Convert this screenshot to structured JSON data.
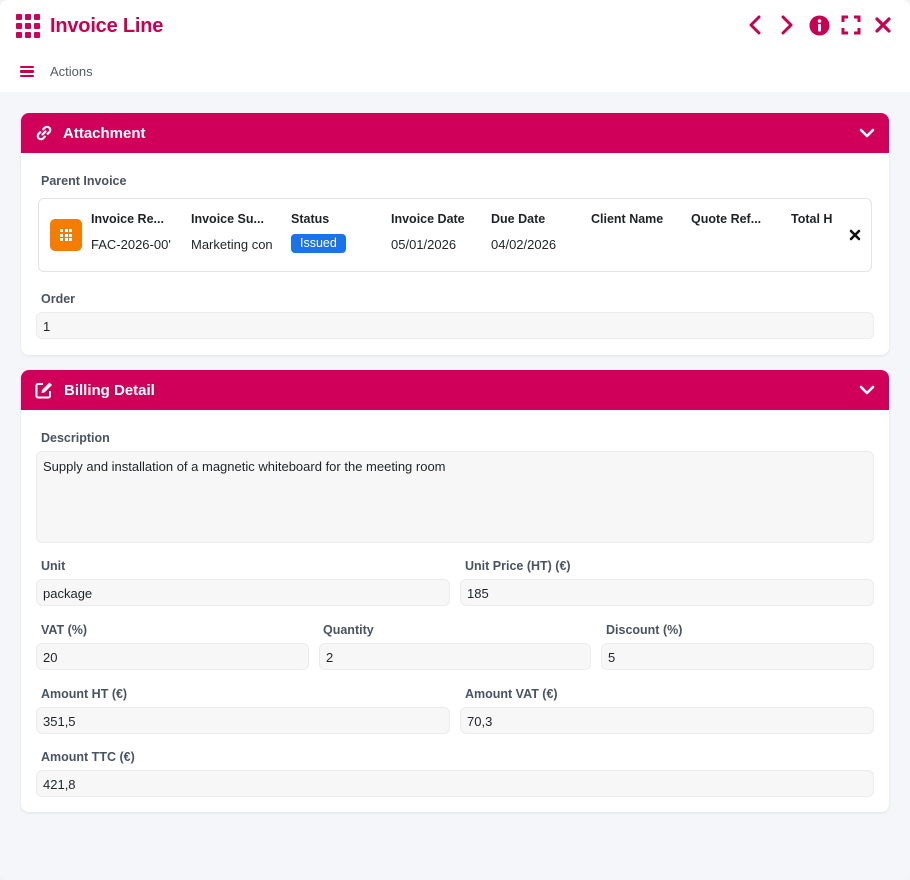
{
  "header": {
    "title": "Invoice Line",
    "actions_label": "Actions"
  },
  "attachment": {
    "title": "Attachment",
    "parent_invoice_label": "Parent Invoice",
    "invoice": {
      "columns": [
        {
          "header": "Invoice Re...",
          "value": "FAC-2026-00'"
        },
        {
          "header": "Invoice Su...",
          "value": "Marketing con"
        },
        {
          "header": "Status",
          "value": "Issued"
        },
        {
          "header": "Invoice Date",
          "value": "05/01/2026"
        },
        {
          "header": "Due Date",
          "value": "04/02/2026"
        },
        {
          "header": "Client Name",
          "value": ""
        },
        {
          "header": "Quote Ref...",
          "value": ""
        },
        {
          "header": "Total H",
          "value": ""
        }
      ]
    },
    "order_label": "Order",
    "order_value": "1"
  },
  "billing": {
    "title": "Billing Detail",
    "description_label": "Description",
    "description_value": "Supply and installation of a magnetic whiteboard for the meeting room",
    "unit_label": "Unit",
    "unit_value": "package",
    "unit_price_label": "Unit Price (HT) (€)",
    "unit_price_value": "185",
    "vat_label": "VAT (%)",
    "vat_value": "20",
    "quantity_label": "Quantity",
    "quantity_value": "2",
    "discount_label": "Discount (%)",
    "discount_value": "5",
    "amount_ht_label": "Amount HT (€)",
    "amount_ht_value": "351,5",
    "amount_vat_label": "Amount VAT (€)",
    "amount_vat_value": "70,3",
    "amount_ttc_label": "Amount TTC (€)",
    "amount_ttc_value": "421,8"
  },
  "colors": {
    "accent": "#d0005a",
    "status_badge": "#1a73e8",
    "invoice_icon": "#f57c00"
  },
  "icons": [
    "apps-grid-icon",
    "chevron-left-icon",
    "chevron-right-icon",
    "info-icon",
    "fullscreen-icon",
    "close-icon",
    "menu-icon",
    "link-icon",
    "edit-icon",
    "chevron-down-icon"
  ]
}
